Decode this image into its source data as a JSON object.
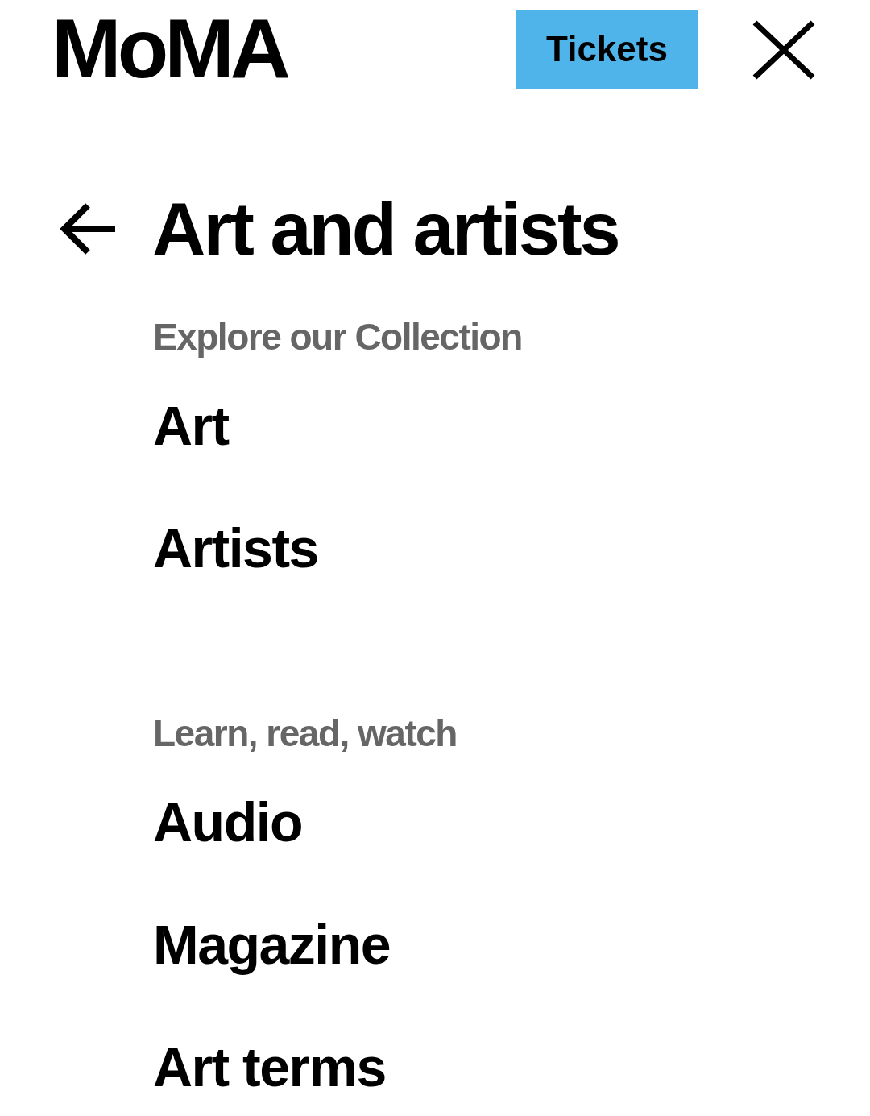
{
  "header": {
    "logo": "MoMA",
    "tickets_button": "Tickets"
  },
  "title": "Art and artists",
  "sections": [
    {
      "heading": "Explore our Collection",
      "items": [
        "Art",
        "Artists"
      ]
    },
    {
      "heading": "Learn, read, watch",
      "items": [
        "Audio",
        "Magazine",
        "Art terms"
      ]
    }
  ]
}
